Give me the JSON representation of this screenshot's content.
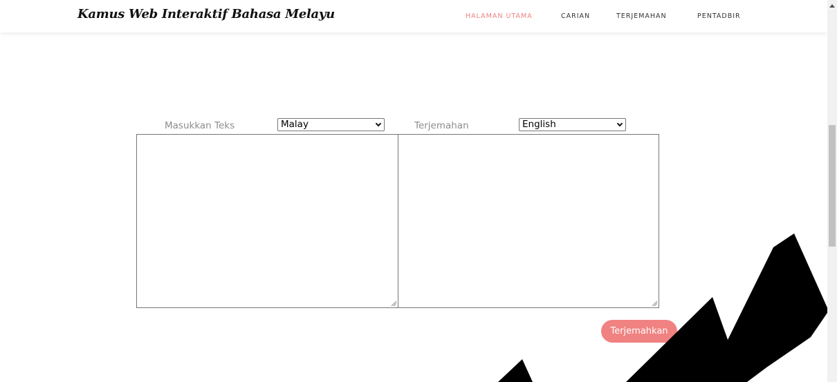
{
  "header": {
    "brand": "Kamus Web Interaktif Bahasa Melayu",
    "nav": [
      {
        "label": "HALAMAN UTAMA",
        "active": true
      },
      {
        "label": "CARIAN",
        "active": false
      },
      {
        "label": "TERJEMAHAN",
        "active": false
      },
      {
        "label": "PENTADBIR",
        "active": false
      }
    ]
  },
  "translator": {
    "source_label": "Masukkan Teks",
    "source_language": "Malay",
    "target_label": "Terjemahan",
    "target_language": "English",
    "source_text": "",
    "target_text": "",
    "button_label": "Terjemahkan"
  },
  "colors": {
    "accent": "#f08282",
    "watermark": "#000000"
  }
}
